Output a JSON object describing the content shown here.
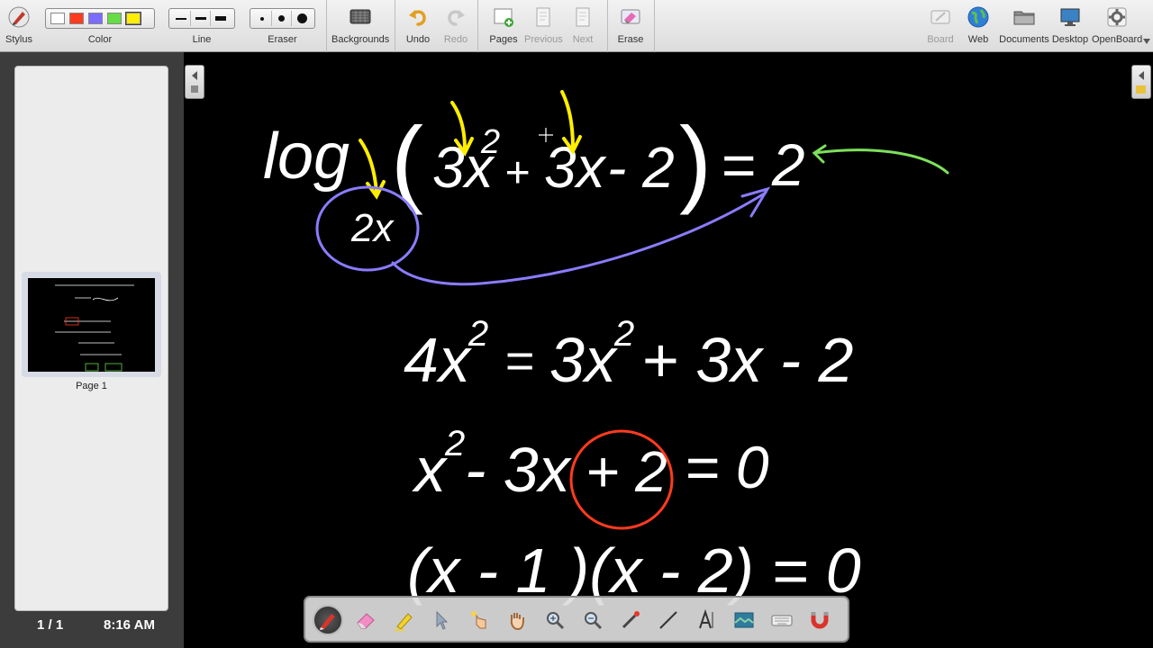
{
  "toolbar": {
    "stylus": "Stylus",
    "color": "Color",
    "line": "Line",
    "eraser": "Eraser",
    "backgrounds": "Backgrounds",
    "undo": "Undo",
    "redo": "Redo",
    "pages": "Pages",
    "previous": "Previous",
    "next": "Next",
    "erase": "Erase",
    "board": "Board",
    "web": "Web",
    "documents": "Documents",
    "desktop": "Desktop",
    "openboard": "OpenBoard",
    "colors": [
      "#ffffff",
      "#ff3b1f",
      "#7b6cff",
      "#66dd44",
      "#ffee00"
    ]
  },
  "sidebar": {
    "thumbnail_label": "Page 1",
    "page_count": "1 / 1",
    "clock": "8:16 AM"
  },
  "board": {
    "eq1_log": "log",
    "eq1_base": "2x",
    "eq1_open": "(",
    "eq1_a": "3x",
    "eq1_exp": "2",
    "eq1_plus": "+",
    "eq1_b": "3x",
    "eq1_minus2": "- 2",
    "eq1_close": ")",
    "eq1_rhs": "= 2",
    "eq2_lhs": "4x",
    "eq2_exp": "2",
    "eq2_eq": "=",
    "eq2_a": "3x",
    "eq2_exp2": "2",
    "eq2_rest": "+ 3x - 2",
    "eq3_x": "x",
    "eq3_exp": "2",
    "eq3_mid": "- 3x",
    "eq3_plus2": "+ 2",
    "eq3_rhs": "= 0",
    "eq4": "(x - 1 )(x - 2) = 0",
    "ink_colors": {
      "white": "#ffffff",
      "yellow": "#ffee00",
      "purple": "#8a7cff",
      "green": "#7ee05a",
      "red": "#ff3b1f"
    }
  },
  "dock": {
    "tools": [
      "pen-icon",
      "eraser-icon",
      "marker-icon",
      "selector-icon",
      "interact-icon",
      "hand-icon",
      "zoom-in-icon",
      "zoom-out-icon",
      "laser-pointer-icon",
      "line-icon",
      "text-icon",
      "capture-icon",
      "keyboard-icon",
      "magnet-icon"
    ]
  }
}
